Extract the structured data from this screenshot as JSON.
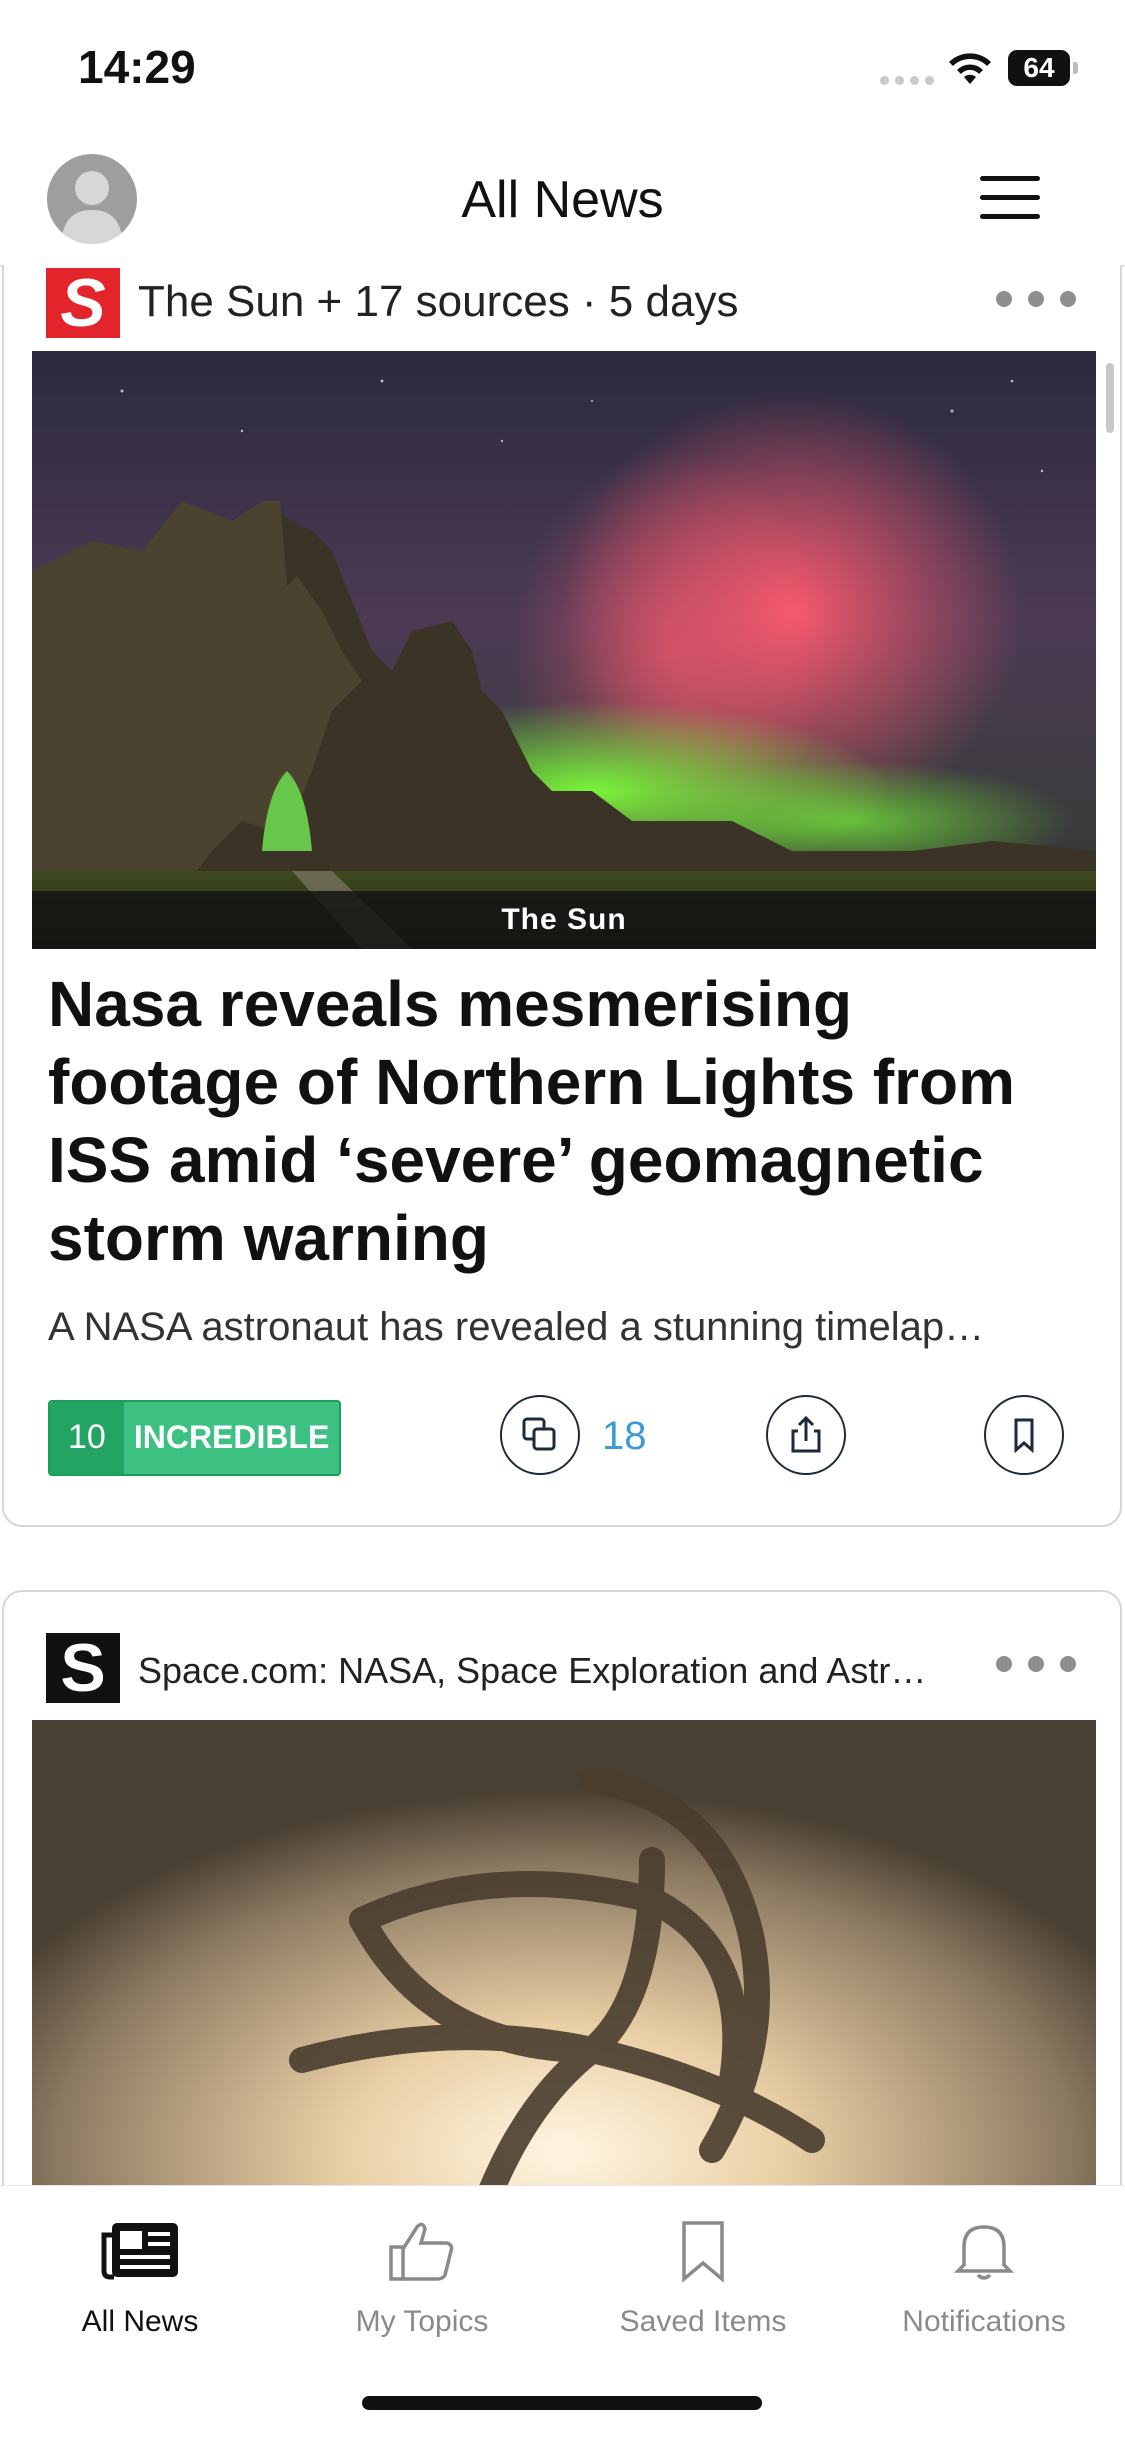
{
  "status_bar": {
    "time": "14:29",
    "battery": "64"
  },
  "header": {
    "title": "All News"
  },
  "cards": [
    {
      "source": "The Sun + 17 sources · 5 days",
      "logo_letter": "S",
      "image_caption": "The Sun",
      "headline": "Nasa reveals mesmerising footage of Northern Lights from ISS amid ‘severe’ geomagnetic storm warning",
      "summary": "A NASA astronaut has revealed a stunning timelap…",
      "rating_number": "10",
      "rating_label": "INCREDIBLE",
      "related_count": "18"
    },
    {
      "source": "Space.com: NASA, Space Exploration and Astr…",
      "logo_letter": "S"
    }
  ],
  "tabs": [
    {
      "label": "All News",
      "icon": "newspaper-icon",
      "active": true
    },
    {
      "label": "My Topics",
      "icon": "thumbs-up-icon"
    },
    {
      "label": "Saved Items",
      "icon": "bookmark-icon"
    },
    {
      "label": "Notifications",
      "icon": "bell-icon"
    }
  ],
  "colors": {
    "rating_dark": "#22a463",
    "rating_light": "#3cc182",
    "count_blue": "#3b9ad9",
    "sun_red": "#e4242b"
  }
}
